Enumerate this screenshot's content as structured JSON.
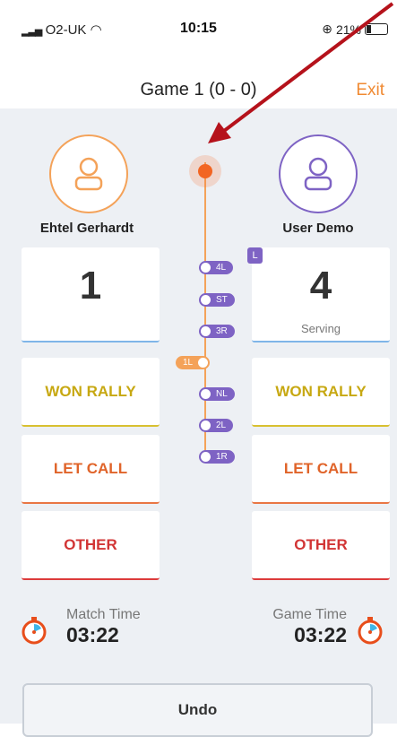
{
  "status_bar": {
    "carrier": "O2-UK",
    "time": "10:15",
    "battery": "21%"
  },
  "header": {
    "title": "Game 1 (0 - 0)",
    "exit_label": "Exit"
  },
  "players": {
    "left": {
      "name": "Ehtel Gerhardt",
      "score": "1",
      "status": ""
    },
    "right": {
      "name": "User Demo",
      "score": "4",
      "status": "Serving",
      "badge": "L"
    }
  },
  "actions": {
    "won_rally": "WON RALLY",
    "let_call": "LET CALL",
    "other": "OTHER"
  },
  "timeline": {
    "markers": [
      "4L",
      "ST",
      "3R",
      "1L",
      "NL",
      "2L",
      "1R"
    ],
    "colors": {
      "left_player": "#f4a259",
      "right_player": "#7e63c4"
    }
  },
  "timers": {
    "match": {
      "label": "Match Time",
      "value": "03:22"
    },
    "game": {
      "label": "Game Time",
      "value": "03:22"
    }
  },
  "undo_label": "Undo",
  "colors": {
    "accent": "#f08a32",
    "annotation_arrow": "#b5121b"
  }
}
